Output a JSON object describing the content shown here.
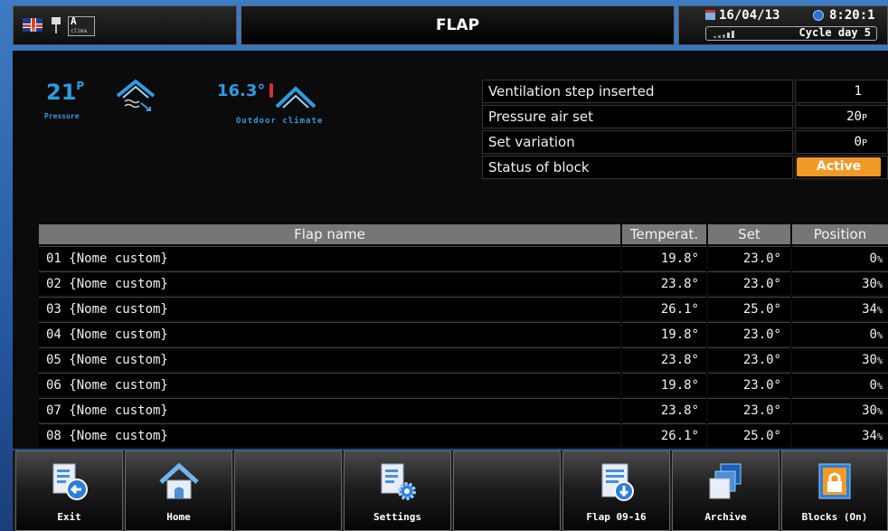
{
  "header": {
    "title": "FLAP",
    "date": "16/04/13",
    "time": "8:20:1",
    "cycle": "Cycle day 5",
    "clima_badge_top": "A",
    "clima_badge_label": "clima",
    "flag_sub": "GB"
  },
  "indicators": {
    "pressure_value": "21",
    "pressure_unit": "P",
    "pressure_label": "Pressure",
    "outdoor_value": "16.3°",
    "outdoor_label": "Outdoor climate"
  },
  "params": [
    {
      "label": "Ventilation step inserted",
      "value": "1",
      "unit": ""
    },
    {
      "label": "Pressure air set",
      "value": "20",
      "unit": "P"
    },
    {
      "label": "Set variation",
      "value": "0",
      "unit": "P"
    },
    {
      "label": "Status of block",
      "value": "Active",
      "unit": ""
    }
  ],
  "table": {
    "headers": [
      "Flap name",
      "Temperat.",
      "Set",
      "Position"
    ],
    "rows": [
      {
        "name": "01 {Nome custom}",
        "temp": "19.8°",
        "set": "23.0°",
        "pos": "0",
        "unit": "%"
      },
      {
        "name": "02 {Nome custom}",
        "temp": "23.8°",
        "set": "23.0°",
        "pos": "30",
        "unit": "%"
      },
      {
        "name": "03 {Nome custom}",
        "temp": "26.1°",
        "set": "25.0°",
        "pos": "34",
        "unit": "%"
      },
      {
        "name": "04 {Nome custom}",
        "temp": "19.8°",
        "set": "23.0°",
        "pos": "0",
        "unit": "%"
      },
      {
        "name": "05 {Nome custom}",
        "temp": "23.8°",
        "set": "23.0°",
        "pos": "30",
        "unit": "%"
      },
      {
        "name": "06 {Nome custom}",
        "temp": "19.8°",
        "set": "23.0°",
        "pos": "0",
        "unit": "%"
      },
      {
        "name": "07 {Nome custom}",
        "temp": "23.8°",
        "set": "23.0°",
        "pos": "30",
        "unit": "%"
      },
      {
        "name": "08 {Nome custom}",
        "temp": "26.1°",
        "set": "25.0°",
        "pos": "34",
        "unit": "%"
      }
    ]
  },
  "toolbar": {
    "exit": "Exit",
    "home": "Home",
    "empty1": "",
    "settings": "Settings",
    "empty2": "",
    "flap_next": "Flap 09-16",
    "archive": "Archive",
    "blocks": "Blocks (On)"
  },
  "colors": {
    "accent_blue": "#2f9be0",
    "active_orange": "#f29a26",
    "header_gray": "#767676"
  },
  "icons": [
    "uk-flag-icon",
    "usb-icon",
    "clima-icon",
    "calendar-icon",
    "clock-icon",
    "signal-icon",
    "pressure-flap-icon",
    "thermometer-icon",
    "outdoor-roof-icon",
    "exit-icon",
    "home-icon",
    "settings-icon",
    "download-document-icon",
    "archive-icon",
    "lock-icon"
  ]
}
